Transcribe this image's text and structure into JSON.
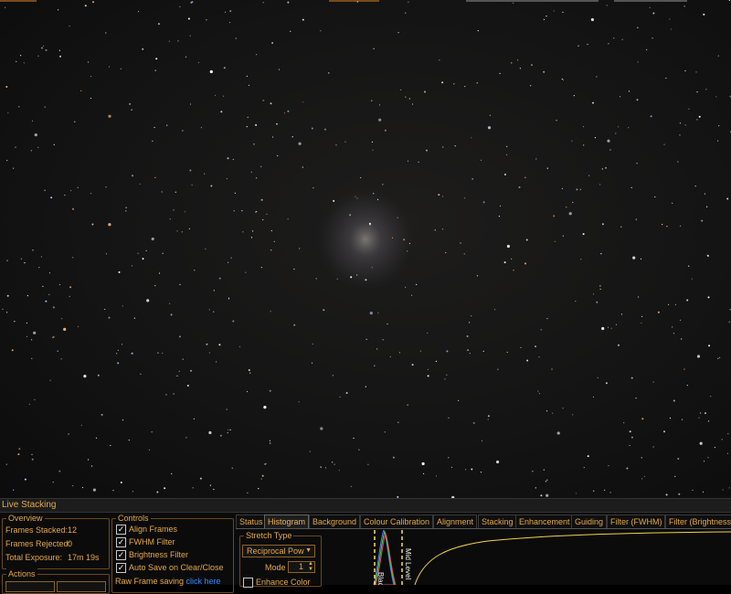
{
  "window": {
    "panel_title": "Live Stacking"
  },
  "overview": {
    "title": "Overview",
    "frames_stacked_label": "Frames Stacked:",
    "frames_stacked_value": "12",
    "frames_rejected_label": "Frames Rejected:",
    "frames_rejected_value": "0",
    "total_exposure_label": "Total Exposure:",
    "total_exposure_value": "17m 19s"
  },
  "actions": {
    "title": "Actions"
  },
  "controls": {
    "title": "Controls",
    "items": [
      {
        "label": "Align Frames",
        "checked": true
      },
      {
        "label": "FWHM Filter",
        "checked": true
      },
      {
        "label": "Brightness Filter",
        "checked": true
      },
      {
        "label": "Auto Save on Clear/Close",
        "checked": true
      }
    ],
    "raw_saving_label": "Raw Frame saving",
    "raw_saving_link": "click here"
  },
  "tabs": [
    {
      "label": "Status",
      "active": false
    },
    {
      "label": "Histogram",
      "active": true
    },
    {
      "label": "Background",
      "active": false
    },
    {
      "label": "Colour Calibration",
      "active": false
    },
    {
      "label": "Alignment",
      "active": false
    },
    {
      "label": "Stacking",
      "active": false
    },
    {
      "label": "Enhancement",
      "active": false
    },
    {
      "label": "Guiding",
      "active": false
    },
    {
      "label": "Filter (FWHM)",
      "active": false
    },
    {
      "label": "Filter (Brightness)",
      "active": false
    }
  ],
  "histogram": {
    "stretch_type_label": "Stretch Type",
    "stretch_type_value": "Reciprocal Pow",
    "mode_label": "Mode",
    "mode_value": "1",
    "enhance_color_label": "Enhance Color",
    "enhance_color_checked": false,
    "black_marker_label": "Black",
    "mid_marker_label": "Mid Level"
  },
  "colors": {
    "accent": "#e6a94a",
    "link": "#2e8bff",
    "marker": "#ffe14a",
    "curve": "#f2d34a"
  }
}
